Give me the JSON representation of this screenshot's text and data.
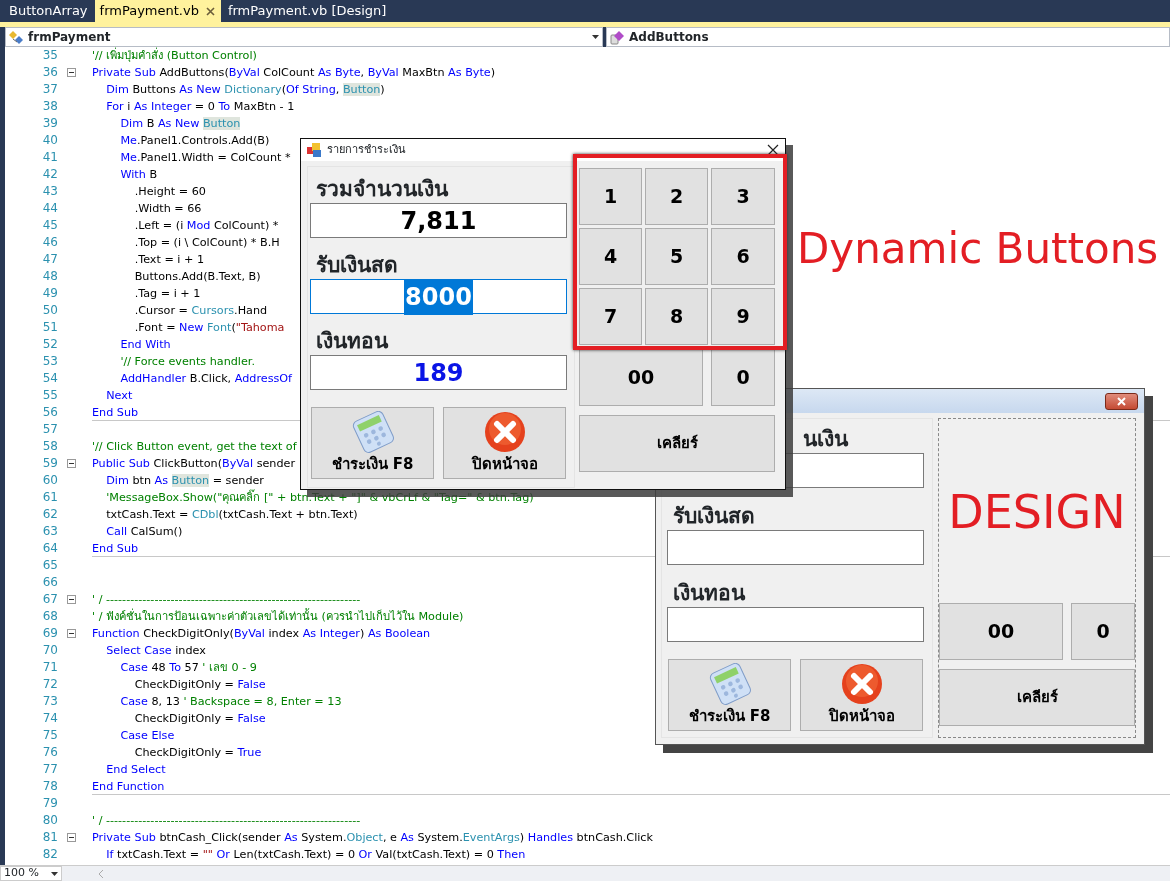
{
  "tabs": [
    {
      "label": "ButtonArray",
      "selected": false
    },
    {
      "label": "frmPayment.vb",
      "selected": true
    },
    {
      "label": "frmPayment.vb [Design]",
      "selected": false
    }
  ],
  "navigation_bar": {
    "class_dropdown": "frmPayment",
    "member_dropdown": "AddButtons"
  },
  "code_lines": [
    {
      "number": "35",
      "tokens": [
        {
          "kind": "comment",
          "text": "'// เพิ่มปุ่มคำสั่ง (Button Control)"
        }
      ]
    },
    {
      "number": "36",
      "fold_marker": true,
      "tokens": [
        {
          "kind": "keyword",
          "text": "Private Sub"
        },
        {
          "kind": "plain",
          "text": " AddButtons("
        },
        {
          "kind": "keyword",
          "text": "ByVal"
        },
        {
          "kind": "plain",
          "text": " ColCount "
        },
        {
          "kind": "keyword",
          "text": "As Byte"
        },
        {
          "kind": "plain",
          "text": ", "
        },
        {
          "kind": "keyword",
          "text": "ByVal"
        },
        {
          "kind": "plain",
          "text": " MaxBtn "
        },
        {
          "kind": "keyword",
          "text": "As Byte"
        },
        {
          "kind": "plain",
          "text": ")"
        }
      ]
    },
    {
      "number": "37",
      "tokens": [
        {
          "kind": "keyword",
          "text": "    Dim"
        },
        {
          "kind": "plain",
          "text": " Buttons "
        },
        {
          "kind": "keyword",
          "text": "As New "
        },
        {
          "kind": "type",
          "text": "Dictionary"
        },
        {
          "kind": "plain",
          "text": "("
        },
        {
          "kind": "keyword",
          "text": "Of String"
        },
        {
          "kind": "plain",
          "text": ", "
        },
        {
          "kind": "reference",
          "text": "Button"
        },
        {
          "kind": "plain",
          "text": ")"
        }
      ]
    },
    {
      "number": "38",
      "tokens": [
        {
          "kind": "keyword",
          "text": "    For"
        },
        {
          "kind": "plain",
          "text": " i "
        },
        {
          "kind": "keyword",
          "text": "As Integer"
        },
        {
          "kind": "plain",
          "text": " = 0 "
        },
        {
          "kind": "keyword",
          "text": "To"
        },
        {
          "kind": "plain",
          "text": " MaxBtn - 1"
        }
      ]
    },
    {
      "number": "39",
      "tokens": [
        {
          "kind": "keyword",
          "text": "        Dim"
        },
        {
          "kind": "plain",
          "text": " B "
        },
        {
          "kind": "keyword",
          "text": "As New "
        },
        {
          "kind": "reference",
          "text": "Button"
        }
      ]
    },
    {
      "number": "40",
      "tokens": [
        {
          "kind": "keyword",
          "text": "        Me"
        },
        {
          "kind": "plain",
          "text": ".Panel1.Controls.Add(B)"
        }
      ]
    },
    {
      "number": "41",
      "tokens": [
        {
          "kind": "keyword",
          "text": "        Me"
        },
        {
          "kind": "plain",
          "text": ".Panel1.Width = ColCount *"
        }
      ]
    },
    {
      "number": "42",
      "tokens": [
        {
          "kind": "keyword",
          "text": "        With"
        },
        {
          "kind": "plain",
          "text": " B"
        }
      ]
    },
    {
      "number": "43",
      "tokens": [
        {
          "kind": "plain",
          "text": "            .Height = 60"
        }
      ]
    },
    {
      "number": "44",
      "tokens": [
        {
          "kind": "plain",
          "text": "            .Width = 66"
        }
      ]
    },
    {
      "number": "45",
      "tokens": [
        {
          "kind": "plain",
          "text": "            .Left = (i "
        },
        {
          "kind": "keyword",
          "text": "Mod"
        },
        {
          "kind": "plain",
          "text": " ColCount) *"
        }
      ]
    },
    {
      "number": "46",
      "tokens": [
        {
          "kind": "plain",
          "text": "            .Top = (i \\ ColCount) * B.H"
        }
      ]
    },
    {
      "number": "47",
      "tokens": [
        {
          "kind": "plain",
          "text": "            .Text = i + 1"
        }
      ]
    },
    {
      "number": "48",
      "tokens": [
        {
          "kind": "plain",
          "text": "            Buttons.Add(B.Text, B)"
        }
      ]
    },
    {
      "number": "49",
      "tokens": [
        {
          "kind": "plain",
          "text": "            .Tag = i + 1"
        }
      ]
    },
    {
      "number": "50",
      "tokens": [
        {
          "kind": "plain",
          "text": "            .Cursor = "
        },
        {
          "kind": "type",
          "text": "Cursors"
        },
        {
          "kind": "plain",
          "text": ".Hand"
        }
      ]
    },
    {
      "number": "51",
      "tokens": [
        {
          "kind": "plain",
          "text": "            .Font = "
        },
        {
          "kind": "keyword",
          "text": "New "
        },
        {
          "kind": "type",
          "text": "Font"
        },
        {
          "kind": "plain",
          "text": "("
        },
        {
          "kind": "string",
          "text": "\"Tahoma"
        }
      ]
    },
    {
      "number": "52",
      "tokens": [
        {
          "kind": "keyword",
          "text": "        End With"
        }
      ]
    },
    {
      "number": "53",
      "tokens": [
        {
          "kind": "comment",
          "text": "        '// Force events handler."
        }
      ]
    },
    {
      "number": "54",
      "tokens": [
        {
          "kind": "keyword",
          "text": "        AddHandler"
        },
        {
          "kind": "plain",
          "text": " B.Click, "
        },
        {
          "kind": "keyword",
          "text": "AddressOf"
        }
      ]
    },
    {
      "number": "55",
      "tokens": [
        {
          "kind": "keyword",
          "text": "    Next"
        }
      ]
    },
    {
      "number": "56",
      "separator_after": true,
      "tokens": [
        {
          "kind": "keyword",
          "text": "End Sub"
        }
      ]
    },
    {
      "number": "57"
    },
    {
      "number": "58",
      "tokens": [
        {
          "kind": "comment",
          "text": "'// Click Button event, get the text of"
        }
      ]
    },
    {
      "number": "59",
      "fold_marker": true,
      "tokens": [
        {
          "kind": "keyword",
          "text": "Public Sub"
        },
        {
          "kind": "plain",
          "text": " ClickButton("
        },
        {
          "kind": "keyword",
          "text": "ByVal"
        },
        {
          "kind": "plain",
          "text": " sender"
        }
      ]
    },
    {
      "number": "60",
      "tokens": [
        {
          "kind": "keyword",
          "text": "    Dim"
        },
        {
          "kind": "plain",
          "text": " btn "
        },
        {
          "kind": "keyword",
          "text": "As "
        },
        {
          "kind": "reference",
          "text": "Button"
        },
        {
          "kind": "plain",
          "text": " = sender"
        }
      ]
    },
    {
      "number": "61",
      "tokens": [
        {
          "kind": "comment",
          "text": "    'MessageBox.Show(\"คุณคลิ๊ก [\" + btn.Text + \"]\" & vbCrLf & \"Tag=\" & btn.Tag)"
        }
      ]
    },
    {
      "number": "62",
      "tokens": [
        {
          "kind": "plain",
          "text": "    txtCash.Text = "
        },
        {
          "kind": "type",
          "text": "CDbl"
        },
        {
          "kind": "plain",
          "text": "(txtCash.Text + btn.Text)"
        }
      ]
    },
    {
      "number": "63",
      "tokens": [
        {
          "kind": "keyword",
          "text": "    Call"
        },
        {
          "kind": "plain",
          "text": " CalSum()"
        }
      ]
    },
    {
      "number": "64",
      "separator_after": true,
      "tokens": [
        {
          "kind": "keyword",
          "text": "End Sub"
        }
      ]
    },
    {
      "number": "65"
    },
    {
      "number": "66"
    },
    {
      "number": "67",
      "fold_marker": true,
      "tokens": [
        {
          "kind": "comment",
          "text": "' / ---------------------------------------------------------------"
        }
      ]
    },
    {
      "number": "68",
      "tokens": [
        {
          "kind": "comment",
          "text": "' / ฟังค์ชั่นในการป้อนเฉพาะค่าตัวเลขได้เท่านั้น (ควรนำไปเก็บไว้ใน Module)"
        }
      ]
    },
    {
      "number": "69",
      "fold_marker": true,
      "tokens": [
        {
          "kind": "keyword",
          "text": "Function"
        },
        {
          "kind": "plain",
          "text": " CheckDigitOnly("
        },
        {
          "kind": "keyword",
          "text": "ByVal"
        },
        {
          "kind": "plain",
          "text": " index "
        },
        {
          "kind": "keyword",
          "text": "As Integer"
        },
        {
          "kind": "plain",
          "text": ") "
        },
        {
          "kind": "keyword",
          "text": "As Boolean"
        }
      ]
    },
    {
      "number": "70",
      "tokens": [
        {
          "kind": "keyword",
          "text": "    Select Case"
        },
        {
          "kind": "plain",
          "text": " index"
        }
      ]
    },
    {
      "number": "71",
      "tokens": [
        {
          "kind": "keyword",
          "text": "        Case"
        },
        {
          "kind": "plain",
          "text": " 48 "
        },
        {
          "kind": "keyword",
          "text": "To"
        },
        {
          "kind": "plain",
          "text": " 57 "
        },
        {
          "kind": "comment",
          "text": "' เลข 0 - 9"
        }
      ]
    },
    {
      "number": "72",
      "tokens": [
        {
          "kind": "plain",
          "text": "            CheckDigitOnly = "
        },
        {
          "kind": "keyword",
          "text": "False"
        }
      ]
    },
    {
      "number": "73",
      "tokens": [
        {
          "kind": "keyword",
          "text": "        Case"
        },
        {
          "kind": "plain",
          "text": " 8, 13 "
        },
        {
          "kind": "comment",
          "text": "' Backspace = 8, Enter = 13"
        }
      ]
    },
    {
      "number": "74",
      "tokens": [
        {
          "kind": "plain",
          "text": "            CheckDigitOnly = "
        },
        {
          "kind": "keyword",
          "text": "False"
        }
      ]
    },
    {
      "number": "75",
      "tokens": [
        {
          "kind": "keyword",
          "text": "        Case Else"
        }
      ]
    },
    {
      "number": "76",
      "tokens": [
        {
          "kind": "plain",
          "text": "            CheckDigitOnly = "
        },
        {
          "kind": "keyword",
          "text": "True"
        }
      ]
    },
    {
      "number": "77",
      "tokens": [
        {
          "kind": "keyword",
          "text": "    End Select"
        }
      ]
    },
    {
      "number": "78",
      "separator_after": true,
      "tokens": [
        {
          "kind": "keyword",
          "text": "End Function"
        }
      ]
    },
    {
      "number": "79"
    },
    {
      "number": "80",
      "tokens": [
        {
          "kind": "comment",
          "text": "' / ---------------------------------------------------------------"
        }
      ]
    },
    {
      "number": "81",
      "fold_marker": true,
      "tokens": [
        {
          "kind": "keyword",
          "text": "Private Sub"
        },
        {
          "kind": "plain",
          "text": " btnCash_Click(sender "
        },
        {
          "kind": "keyword",
          "text": "As"
        },
        {
          "kind": "plain",
          "text": " System."
        },
        {
          "kind": "type",
          "text": "Object"
        },
        {
          "kind": "plain",
          "text": ", e "
        },
        {
          "kind": "keyword",
          "text": "As"
        },
        {
          "kind": "plain",
          "text": " System."
        },
        {
          "kind": "type",
          "text": "EventArgs"
        },
        {
          "kind": "plain",
          "text": ") "
        },
        {
          "kind": "keyword",
          "text": "Handles"
        },
        {
          "kind": "plain",
          "text": " btnCash.Click"
        }
      ]
    },
    {
      "number": "82",
      "tokens": [
        {
          "kind": "keyword",
          "text": "    If"
        },
        {
          "kind": "plain",
          "text": " txtCash.Text = "
        },
        {
          "kind": "string",
          "text": "\"\""
        },
        {
          "kind": "keyword",
          "text": " Or"
        },
        {
          "kind": "plain",
          "text": " Len(txtCash.Text) = 0 "
        },
        {
          "kind": "keyword",
          "text": "Or"
        },
        {
          "kind": "plain",
          "text": " Val(txtCash.Text) = 0 "
        },
        {
          "kind": "keyword",
          "text": "Then"
        }
      ]
    }
  ],
  "zoom": "100 %",
  "payment_dialog": {
    "title": "รายการชำระเงิน",
    "fields": [
      {
        "label": "รวมจำนวนเงิน",
        "value": "7,811",
        "kind": "total",
        "focused": false
      },
      {
        "label": "รับเงินสด",
        "value": "8000",
        "kind": "cash",
        "focused": true
      },
      {
        "label": "เงินทอน",
        "value": "189",
        "kind": "change",
        "focused": false
      }
    ],
    "keypad": [
      "1",
      "2",
      "3",
      "4",
      "5",
      "6",
      "7",
      "8",
      "9"
    ],
    "extra_keys": [
      "00",
      "0"
    ],
    "clear": "เคลียร์",
    "actions": [
      {
        "label": "ชำระเงิน F8",
        "kind": "calculator"
      },
      {
        "label": "ปิดหน้าจอ",
        "kind": "close"
      }
    ]
  },
  "annotation": "Dynamic Buttons",
  "design_window": {
    "fields": [
      {
        "label": "นเงิน"
      },
      {
        "label": "รับเงินสด"
      },
      {
        "label": "เงินทอน"
      }
    ],
    "design_label": "DESIGN",
    "extra_keys": [
      "00",
      "0"
    ],
    "clear": "เคลียร์",
    "actions": [
      {
        "label": "ชำระเงิน F8",
        "kind": "calculator"
      },
      {
        "label": "ปิดหน้าจอ",
        "kind": "close"
      }
    ]
  }
}
